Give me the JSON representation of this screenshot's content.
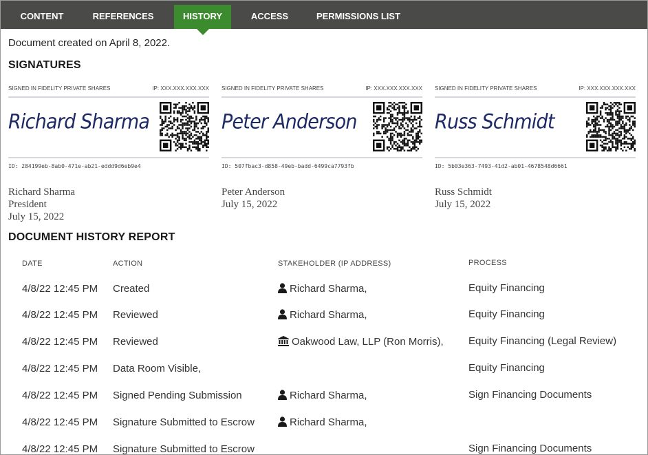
{
  "tabs": [
    {
      "label": "CONTENT"
    },
    {
      "label": "REFERENCES"
    },
    {
      "label": "HISTORY"
    },
    {
      "label": "ACCESS"
    },
    {
      "label": "PERMISSIONS LIST"
    }
  ],
  "created_text": "Document created on April 8, 2022.",
  "signatures_title": "SIGNATURES",
  "signatures": [
    {
      "signed_in": "SIGNED IN FIDELITY PRIVATE SHARES",
      "ip": "IP: XXX.XXX.XXX.XXX",
      "script_name": "Richard Sharma",
      "id": "ID: 284199eb-8ab0-471e-ab21-eddd9d6eb9e4",
      "name": "Richard Sharma",
      "title": "President",
      "date": "July 15, 2022"
    },
    {
      "signed_in": "SIGNED IN FIDELITY PRIVATE SHARES",
      "ip": "IP: XXX.XXX.XXX.XXX",
      "script_name": "Peter Anderson",
      "id": "ID: 507fbac3-d858-49eb-badd-6499ca7793fb",
      "name": "Peter Anderson",
      "title": "",
      "date": "July 15, 2022"
    },
    {
      "signed_in": "SIGNED IN FIDELITY PRIVATE SHARES",
      "ip": "IP: XXX.XXX.XXX.XXX",
      "script_name": "Russ Schmidt",
      "id": "ID: 5b03e363-7493-41d2-ab01-4678548d6661",
      "name": "Russ Schmidt",
      "title": "",
      "date": "July 15, 2022"
    }
  ],
  "history_title": "DOCUMENT HISTORY REPORT",
  "history_headers": {
    "date": "DATE",
    "action": "ACTION",
    "stakeholder": "STAKEHOLDER (IP ADDRESS)",
    "process": "PROCESS"
  },
  "history_rows": [
    {
      "date": "4/8/22 12:45 PM",
      "action": "Created",
      "icon": "person-icon",
      "stakeholder": "Richard Sharma,",
      "process": "Equity Financing"
    },
    {
      "date": "4/8/22 12:45 PM",
      "action": "Reviewed",
      "icon": "person-icon",
      "stakeholder": "Richard Sharma,",
      "process": "Equity Financing"
    },
    {
      "date": "4/8/22 12:45 PM",
      "action": "Reviewed",
      "icon": "bank-icon",
      "stakeholder": "Oakwood Law, LLP (Ron Morris),",
      "process": "Equity Financing (Legal Review)"
    },
    {
      "date": "4/8/22 12:45 PM",
      "action": "Data Room Visible,",
      "icon": "",
      "stakeholder": "",
      "process": "Equity Financing"
    },
    {
      "date": "4/8/22 12:45 PM",
      "action": "Signed Pending Submission",
      "icon": "person-icon",
      "stakeholder": "Richard Sharma,",
      "process": "Sign Financing Documents"
    },
    {
      "date": "4/8/22 12:45 PM",
      "action": "Signature Submitted to Escrow",
      "icon": "person-icon",
      "stakeholder": "Richard Sharma,",
      "process": ""
    },
    {
      "date": "4/8/22 12:45 PM",
      "action": "Signature Submitted to Escrow",
      "icon": "",
      "stakeholder": "",
      "process": "Sign Financing Documents"
    }
  ],
  "colors": {
    "tab_bar": "#4a4a48",
    "tab_active": "#3d8b2f",
    "signature_ink": "#1d2a66"
  }
}
